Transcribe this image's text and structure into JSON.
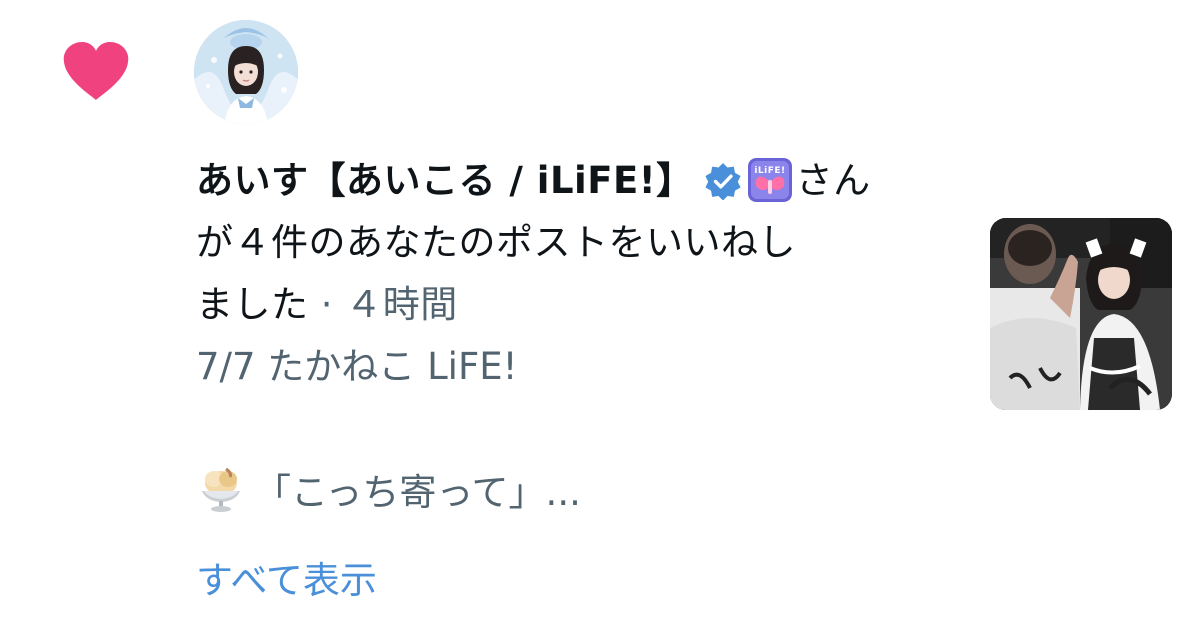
{
  "notification": {
    "type_icon": "heart-icon",
    "heart_color": "#f0427f",
    "avatar_icon": "avatar-image",
    "actor_name": "あいす【あいこる / iLiFE!】",
    "verified_icon": "verified-badge-icon",
    "verified_color": "#4a8fd9",
    "affiliate_badge_icon": "ilife-badge-icon",
    "action_part1": "さん",
    "action_part2": "が４件のあなたのポストをいいねし",
    "action_part3": "ました",
    "separator": " · ",
    "time_ago": "４時間",
    "preview_title": "7/7 たかねこ LiFE!",
    "snippet_icon": "ice-cream-icon",
    "post_snippet": "「こっち寄って」...",
    "show_all_label": "すべて表示",
    "link_color": "#4a8fd9",
    "thumbnail_icon": "post-thumbnail-image"
  }
}
